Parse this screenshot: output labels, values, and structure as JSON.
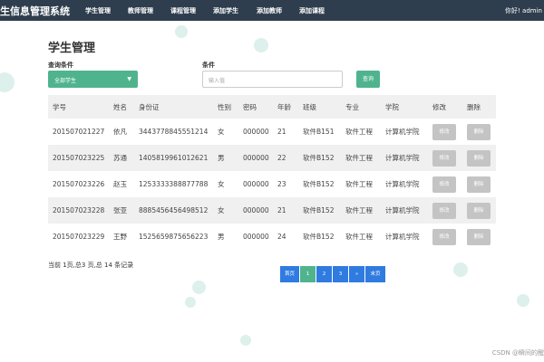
{
  "nav": {
    "brand": "生信息管理系统",
    "items": [
      "学生管理",
      "教师管理",
      "课程管理",
      "添加学生",
      "添加教师",
      "添加课程"
    ],
    "greeting": "你好! admin"
  },
  "page_title": "学生管理",
  "search": {
    "condition_label": "查询条件",
    "select_value": "全部学生",
    "value_label": "条件",
    "placeholder": "输入值",
    "query_button": "查询"
  },
  "table": {
    "headers": [
      "学号",
      "姓名",
      "身份证",
      "性别",
      "密码",
      "年龄",
      "班级",
      "专业",
      "学院",
      "修改",
      "删除"
    ],
    "rows": [
      [
        "201507021227",
        "依凡",
        "3443778845551214",
        "女",
        "000000",
        "21",
        "软件B151",
        "软件工程",
        "计算机学院"
      ],
      [
        "201507023225",
        "苏通",
        "1405819961012621",
        "男",
        "000000",
        "22",
        "软件B152",
        "软件工程",
        "计算机学院"
      ],
      [
        "201507023226",
        "赵玉",
        "1253333388877788",
        "女",
        "000000",
        "23",
        "软件B152",
        "软件工程",
        "计算机学院"
      ],
      [
        "201507023228",
        "张亚",
        "8885456456498512",
        "女",
        "000000",
        "21",
        "软件B152",
        "软件工程",
        "计算机学院"
      ],
      [
        "201507023229",
        "王野",
        "1525659875656223",
        "男",
        "000000",
        "24",
        "软件B152",
        "软件工程",
        "计算机学院"
      ]
    ],
    "edit_label": "修改",
    "delete_label": "删除"
  },
  "footer": {
    "summary": "当前 1页,总3 页,总 14 条记录"
  },
  "pagination": {
    "first": "首页",
    "pages": [
      "1",
      "2",
      "3"
    ],
    "next": "»",
    "last": "末页",
    "current": "1"
  },
  "watermark": "CSDN @瞬间的醒",
  "colors": {
    "navbar": "#2f3e4e",
    "accent": "#4fb48e",
    "pager": "#2f7be0"
  }
}
